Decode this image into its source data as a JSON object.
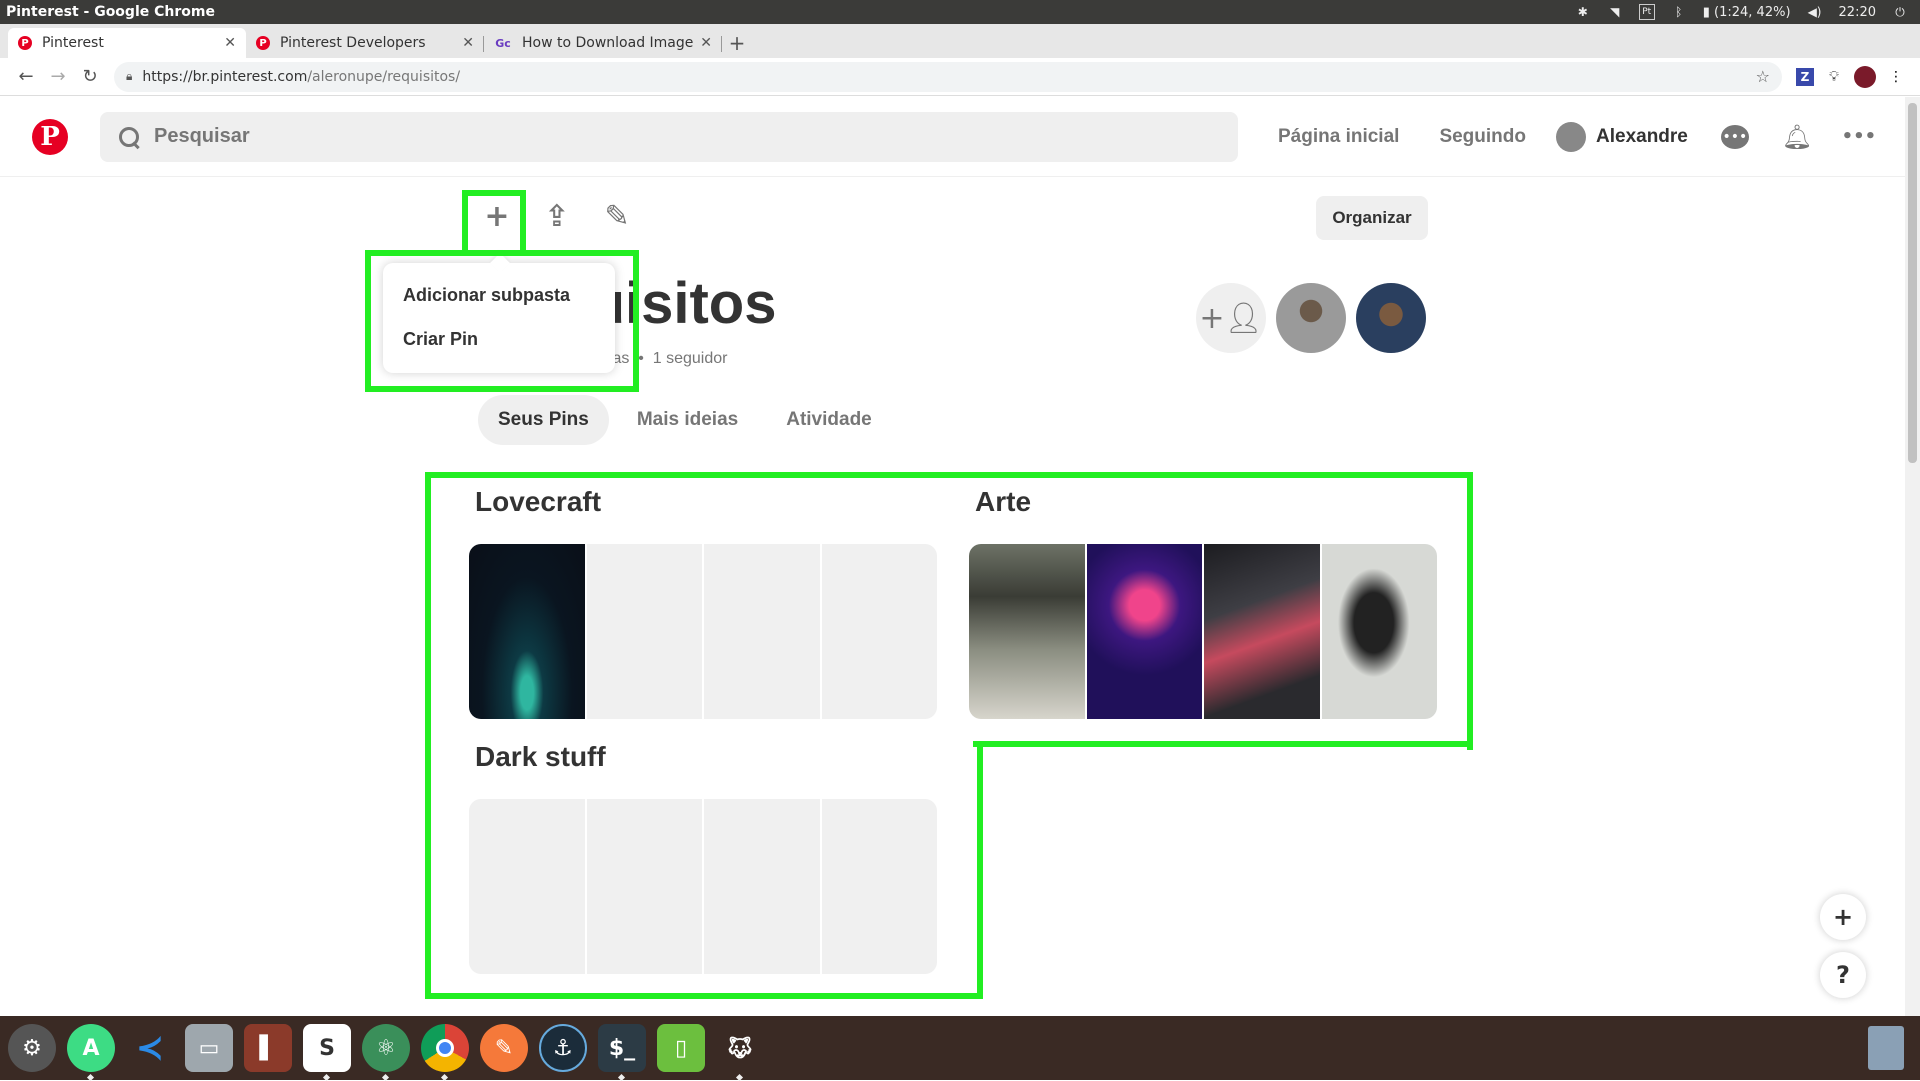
{
  "os": {
    "window_title": "Pinterest - Google Chrome",
    "battery": "(1:24, 42%)",
    "clock": "22:20",
    "keyboard_label": "Pt"
  },
  "browser": {
    "tabs": [
      {
        "label": "Pinterest",
        "favicon": "pinterest-icon",
        "active": true
      },
      {
        "label": "Pinterest Developers",
        "favicon": "pinterest-icon",
        "active": false
      },
      {
        "label": "How to Download Images",
        "favicon": "gc-icon",
        "active": false
      }
    ],
    "new_tab": "+",
    "url_host": "https://br.pinterest.com",
    "url_path": "/aleronupe/requisitos/",
    "ext_z": "Z"
  },
  "header": {
    "logo": "P",
    "search_placeholder": "Pesquisar",
    "nav": [
      "Página inicial",
      "Seguindo"
    ],
    "user_name": "Alexandre",
    "more": "•••"
  },
  "board": {
    "title": "Requisitos",
    "meta_pastas": "stas",
    "meta_separator": "•",
    "meta_followers": "1 seguidor",
    "organize_label": "Organizar",
    "dropdown": [
      "Adicionar subpasta",
      "Criar Pin"
    ],
    "tabs": [
      "Seus Pins",
      "Mais ideias",
      "Atividade"
    ]
  },
  "sections": [
    {
      "name": "Lovecraft"
    },
    {
      "name": "Arte"
    },
    {
      "name": "Dark stuff"
    }
  ],
  "fabs": {
    "add": "+",
    "help": "?"
  },
  "colors": {
    "pinterest_red": "#e60023",
    "highlight_green": "#22ee22"
  }
}
